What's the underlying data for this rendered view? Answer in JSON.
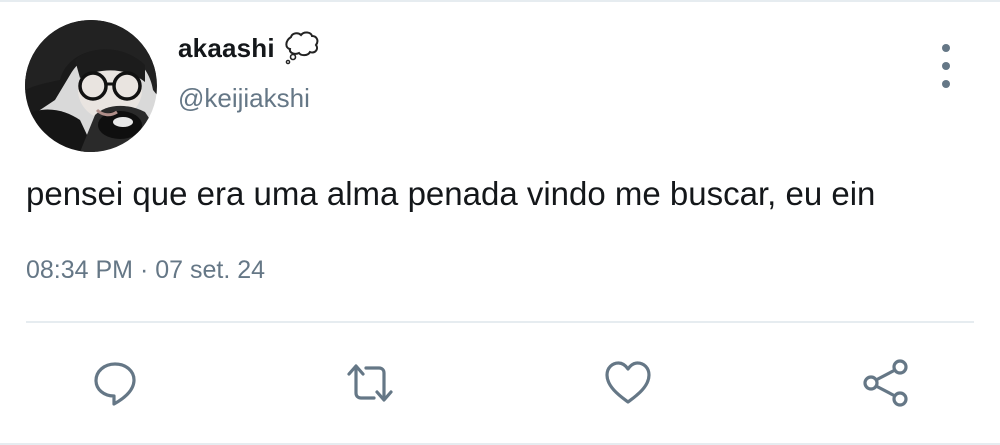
{
  "tweet": {
    "author": {
      "display_name": "akaashi",
      "handle": "@keijiakshi",
      "name_emoji": "thought-balloon-icon",
      "avatar": "avatar-photo"
    },
    "text": "pensei que era uma alma penada vindo me buscar, eu ein",
    "timestamp": "08:34 PM · 07 set. 24"
  },
  "actions": [
    {
      "name": "reply",
      "icon": "reply-icon"
    },
    {
      "name": "retweet",
      "icon": "retweet-icon"
    },
    {
      "name": "like",
      "icon": "heart-icon"
    },
    {
      "name": "share",
      "icon": "share-icon"
    }
  ],
  "menu": {
    "icon": "more-vertical-icon"
  },
  "colors": {
    "text_primary": "#14171a",
    "text_secondary": "#657786",
    "divider": "#e6ecf0",
    "icon": "#657786"
  }
}
